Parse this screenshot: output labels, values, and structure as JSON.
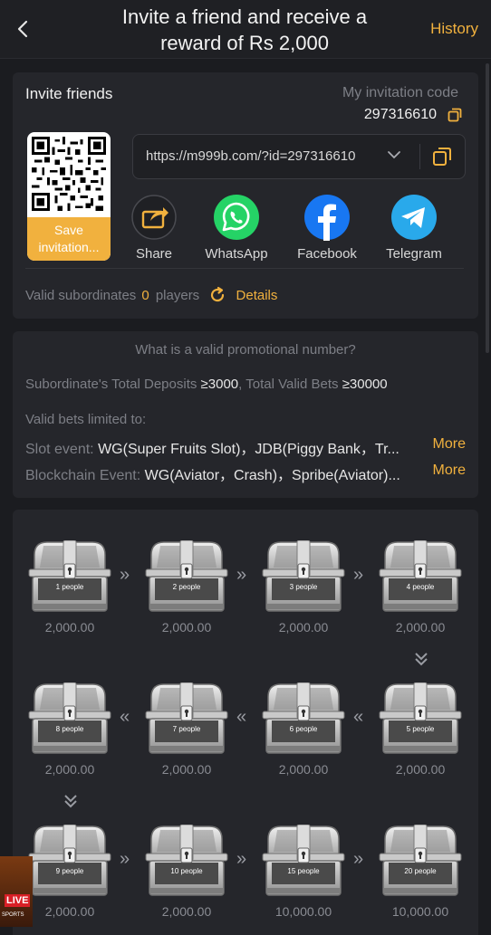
{
  "header": {
    "title_line1": "Invite a friend and receive a",
    "title_line2": "reward of Rs 2,000",
    "history_label": "History"
  },
  "invite": {
    "title": "Invite friends",
    "code_label": "My invitation code",
    "code_value": "297316610",
    "save_label_line1": "Save",
    "save_label_line2": "invitation...",
    "link": "https://m999b.com/?id=297316610",
    "share_options": [
      {
        "label": "Share",
        "icon": "share-icon"
      },
      {
        "label": "WhatsApp",
        "icon": "whatsapp-icon"
      },
      {
        "label": "Facebook",
        "icon": "facebook-icon"
      },
      {
        "label": "Telegram",
        "icon": "telegram-icon"
      }
    ],
    "valid_label": "Valid subordinates",
    "valid_count": "0",
    "valid_unit": "players",
    "details_label": "Details"
  },
  "promo_rules": {
    "question": "What is a valid promotional number?",
    "deposits_label": "Subordinate's Total Deposits",
    "deposits_value": "≥3000",
    "sep": ",",
    "bets_label": "Total Valid Bets",
    "bets_value": "≥30000",
    "limited_label": "Valid bets limited to:",
    "slot_label": "Slot event:",
    "slot_value": "WG(Super Fruits Slot)，JDB(Piggy Bank，Tr...",
    "blockchain_label": "Blockchain Event:",
    "blockchain_value": "WG(Aviator，Crash)，Spribe(Aviator)...",
    "more_label": "More"
  },
  "rewards": [
    {
      "people": "1 people",
      "amount": "2,000.00"
    },
    {
      "people": "2 people",
      "amount": "2,000.00"
    },
    {
      "people": "3 people",
      "amount": "2,000.00"
    },
    {
      "people": "4 people",
      "amount": "2,000.00"
    },
    {
      "people": "5 people",
      "amount": "2,000.00"
    },
    {
      "people": "6 people",
      "amount": "2,000.00"
    },
    {
      "people": "7 people",
      "amount": "2,000.00"
    },
    {
      "people": "8 people",
      "amount": "2,000.00"
    },
    {
      "people": "9 people",
      "amount": "2,000.00"
    },
    {
      "people": "10 people",
      "amount": "2,000.00"
    },
    {
      "people": "15 people",
      "amount": "10,000.00"
    },
    {
      "people": "20 people",
      "amount": "10,000.00"
    }
  ],
  "live_badge": {
    "live": "LIVE",
    "sports": "SPORTS"
  },
  "colors": {
    "accent": "#f1b13e",
    "background": "#1b1c20",
    "card": "#25262b",
    "whatsapp": "#25d366",
    "facebook": "#1877f2",
    "telegram": "#29a9eb"
  }
}
